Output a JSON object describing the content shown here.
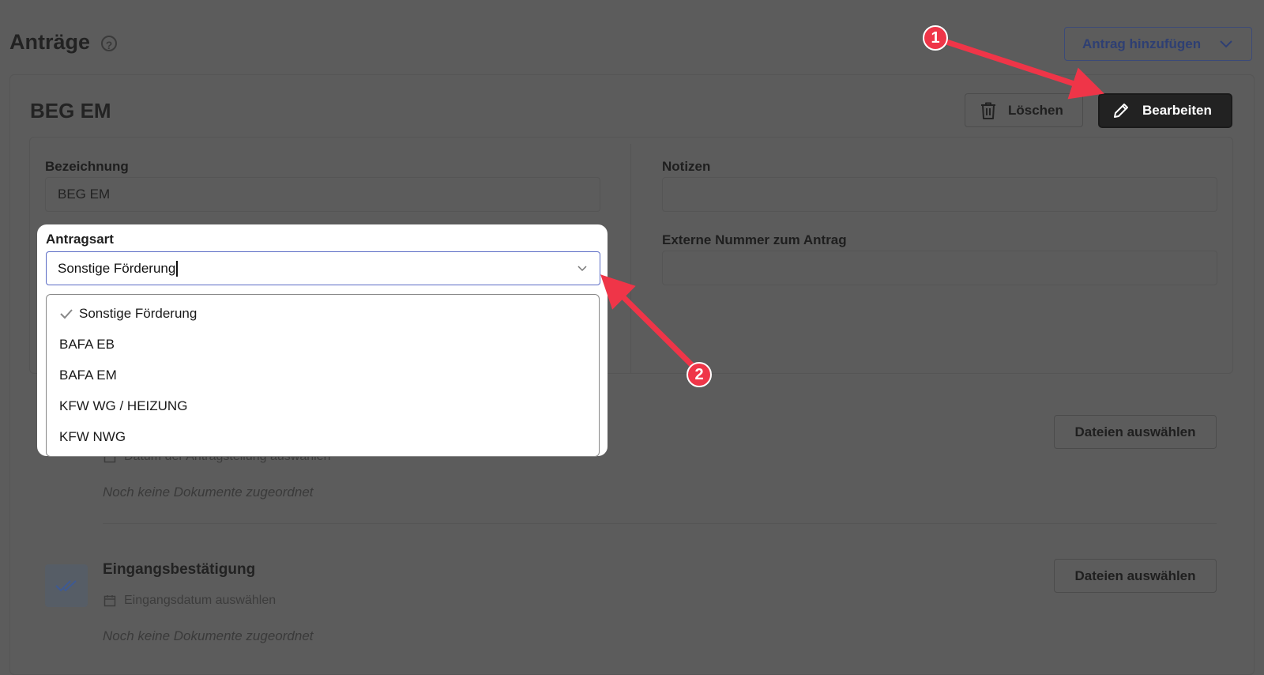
{
  "page": {
    "title": "Anträge",
    "help_icon": "?"
  },
  "header": {
    "add_button_label": "Antrag hinzufügen"
  },
  "card": {
    "title": "BEG EM",
    "delete_label": "Löschen",
    "edit_label": "Bearbeiten"
  },
  "form": {
    "bezeichnung_label": "Bezeichnung",
    "bezeichnung_value": "BEG EM",
    "notizen_label": "Notizen",
    "notizen_value": "",
    "externe_label": "Externe Nummer zum Antrag",
    "externe_value": ""
  },
  "dropdown": {
    "label": "Antragsart",
    "selected": "Sonstige Förderung",
    "options": [
      "Sonstige Förderung",
      "BAFA EB",
      "BAFA EM",
      "KFW WG / HEIZUNG",
      "KFW NWG"
    ]
  },
  "sections": [
    {
      "date_placeholder": "Datum der Antragstellung auswählen",
      "empty_text": "Noch keine Dokumente zugeordnet",
      "files_button": "Dateien auswählen"
    },
    {
      "title": "Eingangsbestätigung",
      "date_placeholder": "Eingangsdatum auswählen",
      "empty_text": "Noch keine Dokumente zugeordnet",
      "files_button": "Dateien auswählen"
    }
  ],
  "annotations": {
    "badge1": "1",
    "badge2": "2",
    "color": "#ef3548"
  }
}
